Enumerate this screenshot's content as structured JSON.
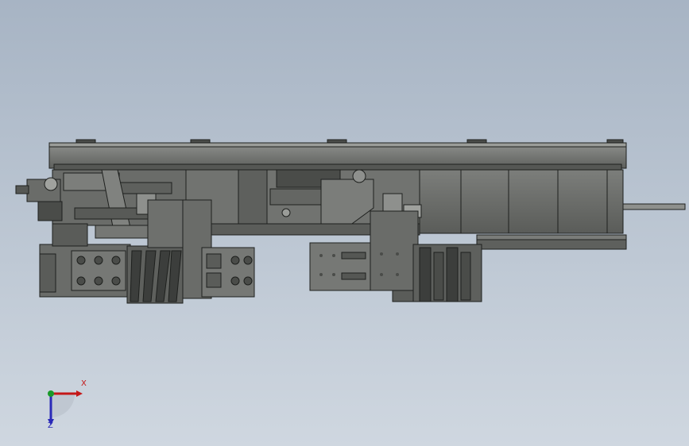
{
  "viewport": {
    "background_top": "#a7b4c4",
    "background_bottom": "#cfd7e0"
  },
  "model": {
    "body_color": "#6f716f",
    "dark_color": "#3c3e3c",
    "light_color": "#8b8d8a",
    "edge_color": "#1e201e"
  },
  "triad": {
    "x_label": "X",
    "z_label": "Z",
    "x_color": "#c41818",
    "z_color": "#2a2ab8",
    "y_color": "#1a9a2a"
  }
}
